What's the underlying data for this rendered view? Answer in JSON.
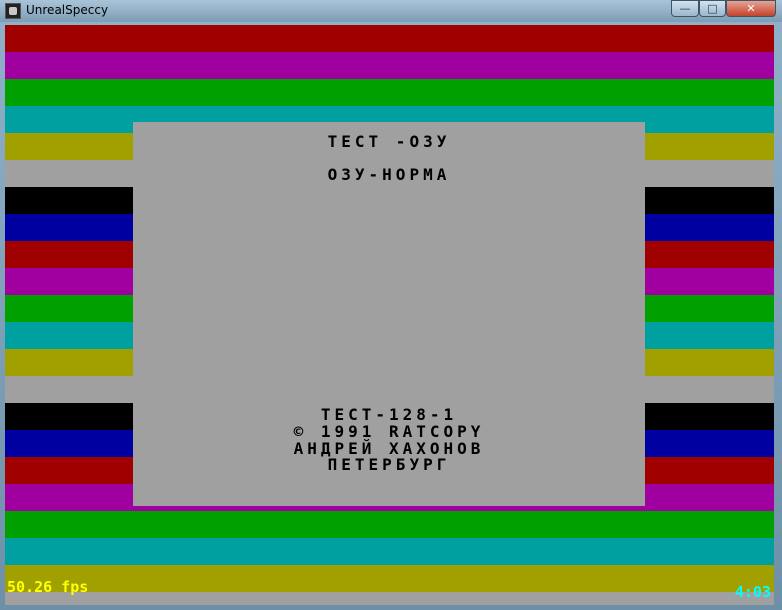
{
  "window": {
    "title": "UnrealSpeccy",
    "app_icon": "speccy-app-icon",
    "controls": {
      "minimize": "—",
      "maximize": "□",
      "close": "✕"
    }
  },
  "palette": {
    "black": "#000000",
    "blue": "#0000a0",
    "red": "#a00000",
    "magenta": "#a000a0",
    "green": "#00a000",
    "cyan": "#00a0a0",
    "yellow": "#a0a000",
    "white": "#a0a0a0"
  },
  "border_stripes": [
    "red",
    "magenta",
    "green",
    "cyan",
    "yellow",
    "white",
    "black",
    "blue",
    "red",
    "magenta",
    "green",
    "cyan",
    "yellow",
    "white",
    "black",
    "blue",
    "red",
    "magenta",
    "green",
    "cyan",
    "yellow",
    "white"
  ],
  "screen": {
    "lines": {
      "test_title": "ТЕСТ -ОЗУ",
      "ram_status": "ОЗУ-НОРМА",
      "test_name": "ТЕСТ-128-1",
      "copyright": "© 1991 RATCOPY",
      "author": "АНДРЕЙ ХАХОНОВ",
      "city": "ПЕТЕРБУРГ"
    }
  },
  "status": {
    "fps": "50.26 fps",
    "clock": "4:03"
  }
}
